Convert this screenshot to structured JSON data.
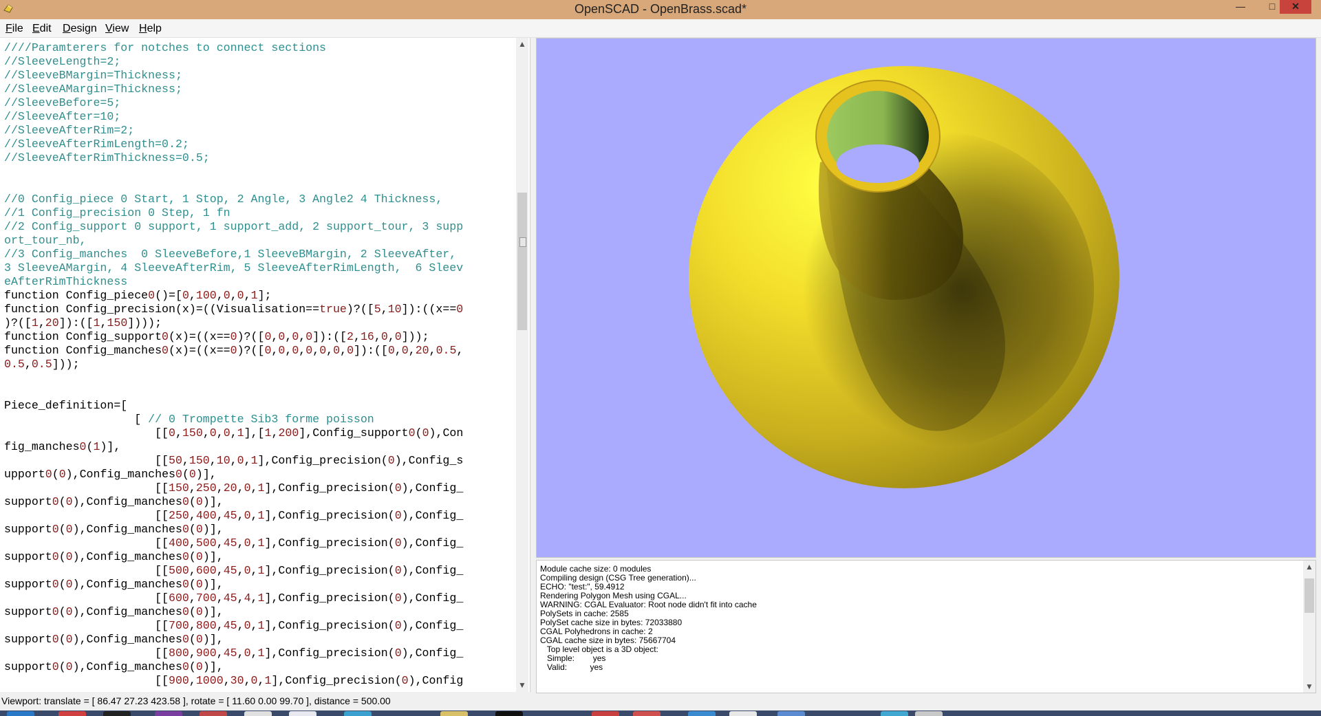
{
  "window": {
    "title": "OpenSCAD - OpenBrass.scad*"
  },
  "menu": [
    "File",
    "Edit",
    "Design",
    "View",
    "Help"
  ],
  "editor_lines": [
    "////Paramterers for notches to connect sections",
    "//SleeveLength=2;",
    "//SleeveBMargin=Thickness;",
    "//SleeveAMargin=Thickness;",
    "//SleeveBefore=5;",
    "//SleeveAfter=10;",
    "//SleeveAfterRim=2;",
    "//SleeveAfterRimLength=0.2;",
    "//SleeveAfterRimThickness=0.5;",
    "",
    "",
    "//0 Config_piece 0 Start, 1 Stop, 2 Angle, 3 Angle2 4 Thickness,",
    "//1 Config_precision 0 Step, 1 fn",
    "//2 Config_support 0 support, 1 support_add, 2 support_tour, 3 supp",
    "ort_tour_nb,",
    "//3 Config_manches  0 SleeveBefore,1 SleeveBMargin, 2 SleeveAfter,",
    "3 SleeveAMargin, 4 SleeveAfterRim, 5 SleeveAfterRimLength,  6 Sleev",
    "eAfterRimThickness",
    "function Config_piece0()=[0,100,0,0,1];",
    "function Config_precision(x)=((Visualisation==true)?([5,10]):((x==0",
    ")?([1,20]):([1,150])));",
    "function Config_support0(x)=((x==0)?([0,0,0,0]):([2,16,0,0]));",
    "function Config_manches0(x)=((x==0)?([0,0,0,0,0,0,0]):([0,0,20,0.5,",
    "0.5,0.5]));",
    "",
    "",
    "Piece_definition=[",
    "                   [ // 0 Trompette Sib3 forme poisson",
    "                      [[0,150,0,0,1],[1,200],Config_support0(0),Con",
    "fig_manches0(1)],",
    "                      [[50,150,10,0,1],Config_precision(0),Config_s",
    "upport0(0),Config_manches0(0)],",
    "                      [[150,250,20,0,1],Config_precision(0),Config_",
    "support0(0),Config_manches0(0)],",
    "                      [[250,400,45,0,1],Config_precision(0),Config_",
    "support0(0),Config_manches0(0)],",
    "                      [[400,500,45,0,1],Config_precision(0),Config_",
    "support0(0),Config_manches0(0)],",
    "                      [[500,600,45,0,1],Config_precision(0),Config_",
    "support0(0),Config_manches0(0)],",
    "                      [[600,700,45,4,1],Config_precision(0),Config_",
    "support0(0),Config_manches0(0)],",
    "                      [[700,800,45,0,1],Config_precision(0),Config_",
    "support0(0),Config_manches0(0)],",
    "                      [[800,900,45,0,1],Config_precision(0),Config_",
    "support0(0),Config_manches0(0)],",
    "                      [[900,1000,30,0,1],Config_precision(0),Config"
  ],
  "console_lines": [
    "Module cache size: 0 modules",
    "Compiling design (CSG Tree generation)...",
    "ECHO: \"test:\", 59.4912",
    "Rendering Polygon Mesh using CGAL...",
    "WARNING: CGAL Evaluator: Root node didn't fit into cache",
    "PolySets in cache: 2585",
    "PolySet cache size in bytes: 72033880",
    "CGAL Polyhedrons in cache: 2",
    "CGAL cache size in bytes: 75667704",
    "   Top level object is a 3D object:",
    "   Simple:        yes",
    "   Valid:          yes"
  ],
  "status": "Viewport: translate = [ 86.47 27.23 423.58 ], rotate = [ 11.60 0.00 99.70 ], distance = 500.00",
  "colors": {
    "viewport_bg": "#aaaaff",
    "model_yellow": "#f0e040",
    "inner_green": "#9cc960",
    "comment": "#2f8f8f",
    "number": "#8b1a1a",
    "titlebar": "#d9a87a"
  },
  "icons": {
    "app": "openscad-icon",
    "minimize": "minimize-icon",
    "maximize": "maximize-icon",
    "close": "close-icon"
  }
}
